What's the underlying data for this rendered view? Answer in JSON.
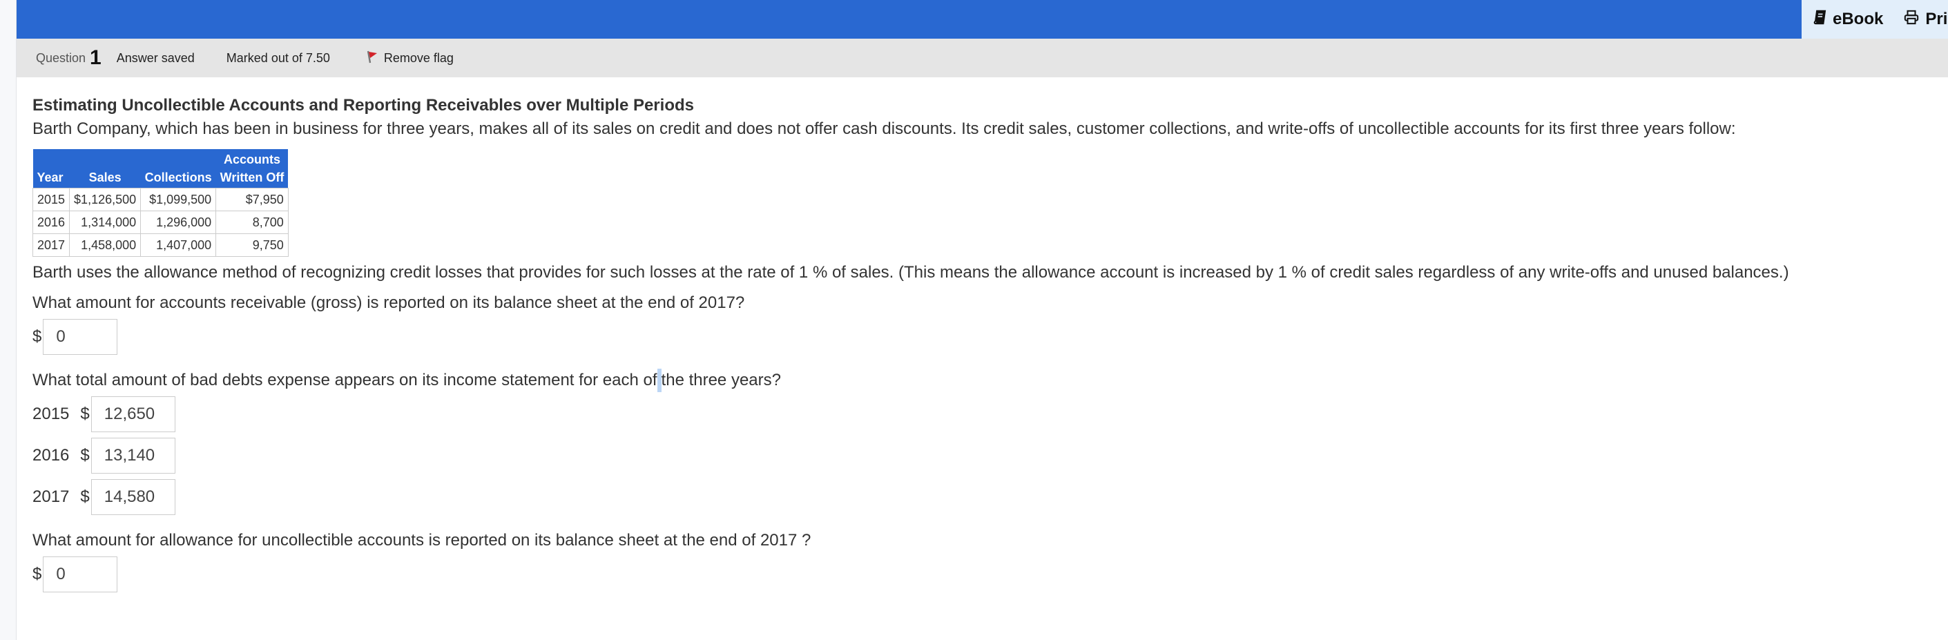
{
  "toolbar": {
    "ebook_label": "eBook",
    "print_label": "Print",
    "ebook_icon": "book-icon",
    "print_icon": "printer-icon"
  },
  "info": {
    "question_label": "Question",
    "question_number": "1",
    "status": "Answer saved",
    "marks": "Marked out of 7.50",
    "flag_label": "Remove flag",
    "flag_icon": "flag-icon"
  },
  "question": {
    "title": "Estimating Uncollectible Accounts and Reporting Receivables over Multiple Periods",
    "intro": "Barth Company, which has been in business for three years, makes all of its sales on credit and does not offer cash discounts. Its credit sales, customer collections, and write-offs of uncollectible accounts for its first three years follow:",
    "table": {
      "headers": [
        "Year",
        "Sales",
        "Collections",
        "Accounts Written Off"
      ],
      "header_top": "Accounts",
      "header_bottom": "Written Off",
      "rows": [
        [
          "2015",
          "$1,126,500",
          "$1,099,500",
          "$7,950"
        ],
        [
          "2016",
          "1,314,000",
          "1,296,000",
          "8,700"
        ],
        [
          "2017",
          "1,458,000",
          "1,407,000",
          "9,750"
        ]
      ]
    },
    "method": "Barth uses the allowance method of recognizing credit losses that provides for such losses at the rate of 1 % of sales. (This means the allowance account is increased by 1 % of credit sales regardless of any write-offs and unused balances.)",
    "q1": {
      "text": "What amount for accounts receivable (gross) is reported on its balance sheet at the end of 2017?",
      "currency": "$",
      "value": "0"
    },
    "q2": {
      "text_before": "What total amount of bad debts expense appears on its income statement for each of",
      "text_after": "the three years?",
      "rows": [
        {
          "year": "2015",
          "currency": "$",
          "value": "12,650"
        },
        {
          "year": "2016",
          "currency": "$",
          "value": "13,140"
        },
        {
          "year": "2017",
          "currency": "$",
          "value": "14,580"
        }
      ]
    },
    "q3": {
      "text": "What amount for allowance for uncollectible accounts is reported on its balance sheet at the end of 2017 ?",
      "currency": "$",
      "value": "0"
    }
  }
}
